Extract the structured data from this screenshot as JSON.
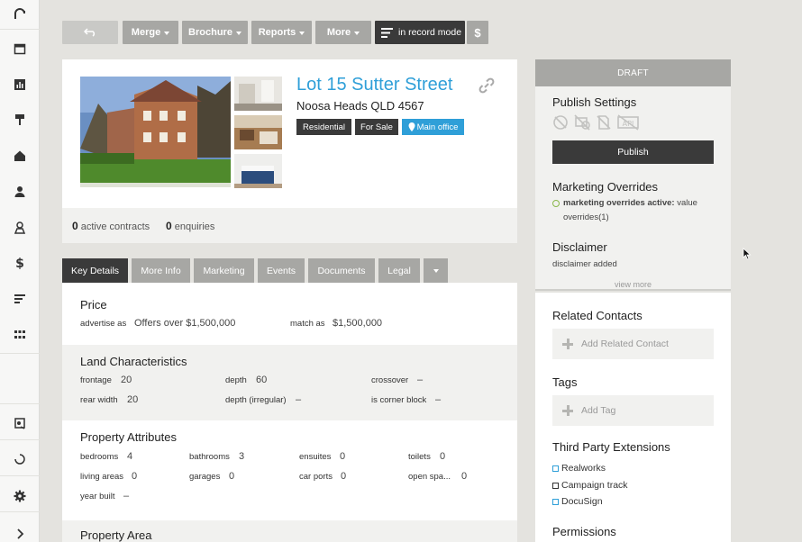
{
  "toolbar": {
    "back_icon": "undo-arrow-icon",
    "merge": "Merge",
    "brochure": "Brochure",
    "reports": "Reports",
    "more": "More",
    "record_mode": "in record mode",
    "dollar": "$"
  },
  "listing": {
    "title": "Lot 15 Sutter Street",
    "address": "Noosa Heads QLD 4567",
    "badges": [
      "Residential",
      "For Sale",
      "Main office"
    ],
    "active_contracts": "0",
    "active_contracts_label": "active contracts",
    "enquiries": "0",
    "enquiries_label": "enquiries"
  },
  "tabs": [
    "Key Details",
    "More Info",
    "Marketing",
    "Events",
    "Documents",
    "Legal"
  ],
  "price": {
    "title": "Price",
    "advertise_label": "advertise as",
    "advertise_value": "Offers over $1,500,000",
    "match_label": "match as",
    "match_value": "$1,500,000"
  },
  "land": {
    "title": "Land Characteristics",
    "frontage_label": "frontage",
    "frontage_value": "20",
    "depth_label": "depth",
    "depth_value": "60",
    "crossover_label": "crossover",
    "crossover_value": "–",
    "rear_label": "rear width",
    "rear_value": "20",
    "depth_irr_label": "depth (irregular)",
    "depth_irr_value": "–",
    "corner_label": "is corner block",
    "corner_value": "–"
  },
  "attributes": {
    "title": "Property Attributes",
    "bedrooms_label": "bedrooms",
    "bedrooms_value": "4",
    "bathrooms_label": "bathrooms",
    "bathrooms_value": "3",
    "ensuites_label": "ensuites",
    "ensuites_value": "0",
    "toilets_label": "toilets",
    "toilets_value": "0",
    "living_label": "living areas",
    "living_value": "0",
    "garages_label": "garages",
    "garages_value": "0",
    "carports_label": "car ports",
    "carports_value": "0",
    "openspa_label": "open spa...",
    "openspa_value": "0",
    "yearbuilt_label": "year built",
    "yearbuilt_value": "–"
  },
  "area": {
    "title": "Property Area"
  },
  "right": {
    "draft": "DRAFT",
    "publish_settings": "Publish Settings",
    "publish_button": "Publish",
    "marketing_overrides": "Marketing Overrides",
    "mo_active_label": "marketing overrides active:",
    "mo_active_value": "value",
    "mo_active_line2": "overrides(1)",
    "disclaimer": "Disclaimer",
    "disclaimer_text": "disclaimer added",
    "view_more": "view more",
    "related_contacts": "Related Contacts",
    "add_related": "Add Related Contact",
    "tags": "Tags",
    "add_tag": "Add Tag",
    "third_party": "Third Party Extensions",
    "extensions": [
      "Realworks",
      "Campaign track",
      "DocuSign"
    ],
    "permissions": "Permissions"
  },
  "colors": {
    "accent": "#2f9fd8",
    "dark_button": "#3a3a3a",
    "grey_button": "#a7a7a4",
    "status_green": "#8ab84a"
  }
}
